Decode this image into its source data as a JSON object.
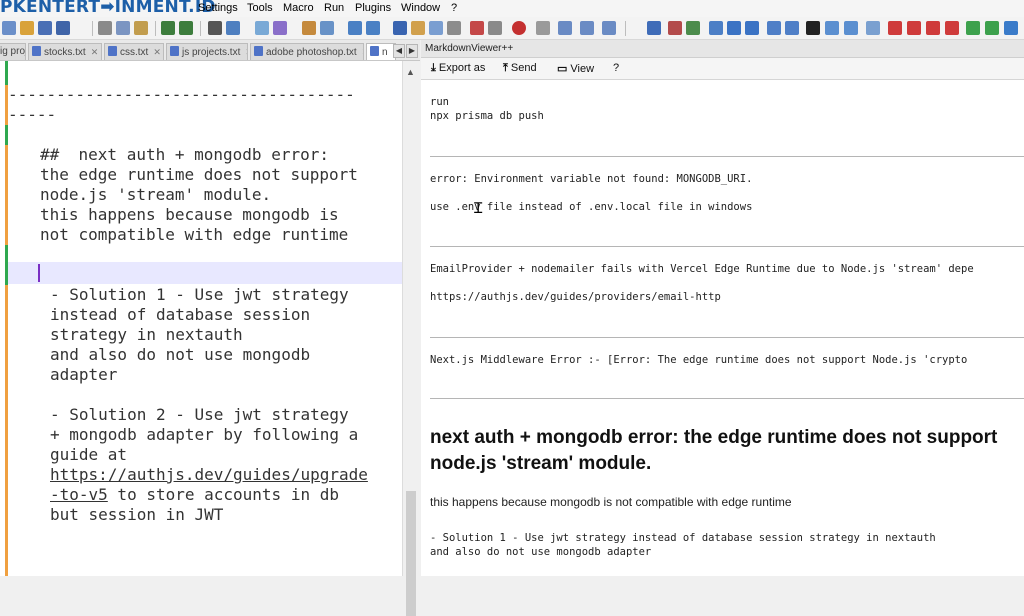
{
  "watermark": "PKENTERT➡INMENT.ID",
  "menu": [
    "Settings",
    "Tools",
    "Macro",
    "Run",
    "Plugins",
    "Window",
    "?"
  ],
  "toolbar_icons": [
    "new-file-icon",
    "open-icon",
    "save-icon",
    "cut-icon",
    "copy-icon",
    "paste-icon",
    "undo-icon",
    "redo-icon",
    "find-icon",
    "replace-icon",
    "zoom-in-icon",
    "zoom-out-icon",
    "record-macro-icon",
    "stop-macro-icon",
    "play-macro-icon",
    "markdown-icon"
  ],
  "colors": {
    "watermark": "#1d5fa8",
    "gutter_saved": "#2fa84f",
    "gutter_modified": "#f0a040",
    "caret_line": "#e8e8ff"
  },
  "tabs": [
    {
      "label": "ig projects.txt"
    },
    {
      "label": "stocks.txt"
    },
    {
      "label": "css.txt"
    },
    {
      "label": "js projects.txt"
    },
    {
      "label": "adobe photoshop.txt"
    },
    {
      "label": "n"
    }
  ],
  "editor": {
    "divider_line1": "------------------------------------",
    "divider_line2": "-----",
    "heading_line1": "##  next auth + mongodb error:",
    "heading_line2": "the edge runtime does not support",
    "heading_line3": "node.js 'stream' module.",
    "heading_line4": "this happens because mongodb is",
    "heading_line5": "not compatible with edge runtime",
    "sol1_line1": "- Solution 1 - Use jwt strategy",
    "sol1_line2": "instead of database session",
    "sol1_line3": "strategy in nextauth",
    "sol1_line4": "and also do not use mongodb",
    "sol1_line5": "adapter",
    "sol2_line1": "- Solution 2 - Use jwt strategy",
    "sol2_line2": "+ mongodb adapter by following a",
    "sol2_line3": "guide at",
    "sol2_link1": "https://authjs.dev/guides/upgrade",
    "sol2_link2": "-to-v5",
    "sol2_line4_rest": " to store accounts in db",
    "sol2_line5": "but session in JWT"
  },
  "viewer": {
    "title": "MarkdownViewer++",
    "export_label": "Export as",
    "send_label": "Send",
    "view_label": "View",
    "help_label": "?",
    "code_run": "run",
    "code_prisma": "npx prisma db push",
    "error_env": "error: Environment variable not found: MONGODB_URI.",
    "use_env": "use .env file instead of .env.local file in windows",
    "email_provider": "EmailProvider + nodemailer fails with Vercel Edge Runtime due to Node.js 'stream' depe",
    "email_link": "https://authjs.dev/guides/providers/email-http",
    "middleware_error": "Next.js Middleware Error :- [Error: The edge runtime does not support Node.js 'crypto",
    "heading": "next auth + mongodb error: the edge runtime does not support node.js 'stream' module.",
    "paragraph": "this happens because mongodb is not compatible with edge runtime",
    "solution1_line1": "- Solution 1 - Use jwt strategy instead of database session strategy in nextauth",
    "solution1_line2": "and also do not use mongodb adapter"
  }
}
